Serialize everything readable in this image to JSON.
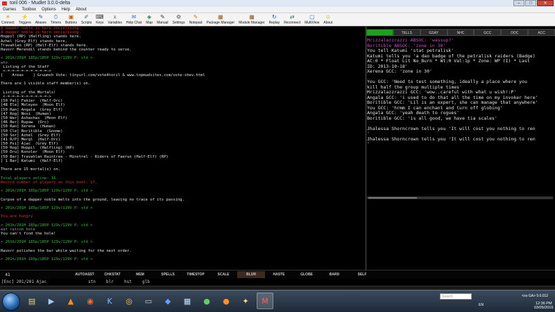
{
  "window": {
    "title": "toril 006 - Mudlet 3.0.0-delta"
  },
  "menubar": [
    "Games",
    "Toolbox",
    "Options",
    "Help",
    "About"
  ],
  "toolbar": [
    {
      "label": "Connect",
      "icon": "connect-icon",
      "glyph": "☀"
    },
    {
      "label": "Triggers",
      "icon": "triggers-icon",
      "glyph": "⚡"
    },
    {
      "label": "Aliases",
      "icon": "aliases-icon",
      "glyph": "✎"
    },
    {
      "label": "Timers",
      "icon": "timers-icon",
      "glyph": "⏱"
    },
    {
      "label": "Buttons",
      "icon": "buttons-icon",
      "glyph": "▣"
    },
    {
      "label": "Scripts",
      "icon": "scripts-icon",
      "glyph": "✐"
    },
    {
      "label": "Keys",
      "icon": "keys-icon",
      "glyph": "⌨"
    },
    {
      "label": "Variables",
      "icon": "variables-icon",
      "glyph": "x"
    },
    {
      "label": "Help Chat",
      "icon": "help-chat-icon",
      "glyph": "✉"
    },
    {
      "label": "Map",
      "icon": "map-icon",
      "glyph": "◈"
    },
    {
      "label": "Manual",
      "icon": "manual-icon",
      "glyph": "✎"
    },
    {
      "label": "Settings",
      "icon": "settings-icon",
      "glyph": "⚙"
    },
    {
      "label": "Notepad",
      "icon": "notepad-icon",
      "glyph": "✎"
    },
    {
      "label": "Package Manager",
      "icon": "package-manager-icon",
      "glyph": "▦"
    },
    {
      "label": "Module Manager",
      "icon": "module-manager-icon",
      "glyph": "▦"
    },
    {
      "label": "Replay",
      "icon": "replay-icon",
      "glyph": "↻"
    },
    {
      "label": "Reconnect",
      "icon": "reconnect-icon",
      "glyph": "⇄"
    },
    {
      "label": "MultiView",
      "icon": "multiview-icon",
      "glyph": "▢"
    },
    {
      "label": "About",
      "icon": "about-icon",
      "glyph": "☺"
    }
  ],
  "main_lines": [
    {
      "t": "A dapper noble is here socializing.",
      "c": "red"
    },
    {
      "t": "A dapper noble is here socializing.",
      "c": "red"
    },
    {
      "t": "Hoppil (RP) (Halfling) stands here.",
      "c": "white"
    },
    {
      "t": "Azhel (Grey Elf) stands here.",
      "c": "white"
    },
    {
      "t": "Travahlan (RP) (Half-Elf) stands here.",
      "c": "white"
    },
    {
      "t": "Havorr Merendil stands behind the counter ready to serve.",
      "c": "white"
    },
    {
      "t": "",
      "c": "white"
    },
    {
      "t": "< 201h/201H 185p/185P 129v/129V P: std >",
      "c": "green"
    },
    {
      "t": "who",
      "c": "gray"
    },
    {
      "t": " Listing of the Staff",
      "c": "white"
    },
    {
      "t": " <-=-=-=-=-=-=-=-=-=->",
      "c": "white"
    },
    {
      "t": "[    Areas    ] Gruumsh Vote: tinyurl.com/vote4toril & www.topmudsites.com/vote-shev.html",
      "c": "white"
    },
    {
      "t": "",
      "c": "white"
    },
    {
      "t": "There are 1 visible staff member(s) on.",
      "c": "white"
    },
    {
      "t": "",
      "c": "white"
    },
    {
      "t": " Listing of the Mortals!",
      "c": "white"
    },
    {
      "t": " <-=-=-=-=-=-=-=-=-=->",
      "c": "white"
    },
    {
      "t": "[50 Pal] Fakier  (Half-Orc)",
      "c": "white"
    },
    {
      "t": "[48 Ele] Moleyen  (Moon Elf)",
      "c": "white"
    },
    {
      "t": "[50 Ran] Angala  (Grey Elf)",
      "c": "white"
    },
    {
      "t": "[47 Rog] Noxi  (Human)",
      "c": "white"
    },
    {
      "t": "[50 War] Ashashas  (Moon Elf)",
      "c": "white"
    },
    {
      "t": "[46 Ber] Rupaw  (Orc)",
      "c": "white"
    },
    {
      "t": "[50 Ran] Xerena  (Human)",
      "c": "white"
    },
    {
      "t": "[50 Cle] Boritible  (Gnome)",
      "c": "white"
    },
    {
      "t": "[50 Sor] Azhel  (Grey Elf)",
      "c": "white"
    },
    {
      "t": "[41 R/P] Mergl  (Half-Orc)",
      "c": "white"
    },
    {
      "t": "[50 Psi] Ajac  (Grey Elf)",
      "c": "white"
    },
    {
      "t": "[50 Rog] Hoppil  (Halfling) (RP)",
      "c": "white"
    },
    {
      "t": "[50 Dru] Konoler  (Moon Elf)",
      "c": "white"
    },
    {
      "t": "[50 Bar] Travahlan Raintree - Minstrel - Riders of Faerun (Half-Elf) (RP)",
      "c": "white"
    },
    {
      "t": "[ 1 Bar] Katumi  (Half-Elf)",
      "c": "white"
    },
    {
      "t": "",
      "c": "white"
    },
    {
      "t": "There are 15 mortal(s) on.",
      "c": "white"
    },
    {
      "t": "",
      "c": "white"
    },
    {
      "t": "Total players online: 16.",
      "c": "green"
    },
    {
      "t": "Record number of players on this boot: 17.",
      "c": "red"
    },
    {
      "t": "",
      "c": "white"
    },
    {
      "t": "< 201h/201H 185p/185P 129v/129V P: std >",
      "c": "green"
    },
    {
      "t": "",
      "c": "white"
    },
    {
      "t": "Corpse of a dapper noble melts into the ground, leaving no trace of its passing.",
      "c": "white"
    },
    {
      "t": "",
      "c": "white"
    },
    {
      "t": "< 201h/201H 185p/185P 129v/129V P: std >",
      "c": "green"
    },
    {
      "t": "",
      "c": "white"
    },
    {
      "t": "You are hungry.",
      "c": "red"
    },
    {
      "t": "",
      "c": "white"
    },
    {
      "t": "< 201h/201H 185p/185P 129v/129V P: std >",
      "c": "green"
    },
    {
      "t": "eat ration hole",
      "c": "gray"
    },
    {
      "t": "You can't find the hole!",
      "c": "white"
    },
    {
      "t": "",
      "c": "white"
    },
    {
      "t": "< 201h/201H 185p/185P 129v/129V P: std >",
      "c": "green"
    },
    {
      "t": "",
      "c": "white"
    },
    {
      "t": "Havorr polishes the bar while waiting for the next order.",
      "c": "white"
    },
    {
      "t": "",
      "c": "white"
    },
    {
      "t": "< 201h/201H 185p/185P 129v/129V P: std >",
      "c": "green"
    }
  ],
  "chat_tabs": [
    "",
    "TELLS",
    "GSAY",
    "NHC",
    "GCC",
    "OOC",
    "ACC"
  ],
  "chat_lines": [
    {
      "t": "Mrizzalazzrazzi ABSOC: 'wassup?'",
      "c": "magenta"
    },
    {
      "t": "Boritible ABSOC: 'zone in 30'",
      "c": "magenta"
    },
    {
      "t": "You tell Katumi 'stat petralisk'",
      "c": "white"
    },
    {
      "t": "Katumi tells you 'a dao badge of the petralisk raiders (Badge)",
      "c": "white"
    },
    {
      "t": "AC:0 * Float Lit No_Burn * Wt:0 Val:1p * Zone: WP (I) * Last",
      "c": "white"
    },
    {
      "t": "ID: 2013-10-18'",
      "c": "white"
    },
    {
      "t": "Xerena GCC: 'zone in 30'",
      "c": "white"
    },
    {
      "t": "",
      "c": "white"
    },
    {
      "t": "You GCC: 'Need to test something, ideally a place where you",
      "c": "white"
    },
    {
      "t": "kill half the group multiple times'",
      "c": "white"
    },
    {
      "t": "Mrizzalazzrazzi GCC: 'wow..careful with what u wish!:P'",
      "c": "white"
    },
    {
      "t": "Angala GCC: 'i used to do that all the time on my invoker here'",
      "c": "white"
    },
    {
      "t": "Boritible GCC: 'Lil is an expert, she can manage that anywhere'",
      "c": "white"
    },
    {
      "t": "You GCC: 'hrmm I can enchant and turn off globing'",
      "c": "white"
    },
    {
      "t": "Angala GCC: 'yeah death to rogues'",
      "c": "white"
    },
    {
      "t": "Boritible GCC: 'is all good, we have tia scales'",
      "c": "white"
    },
    {
      "t": "",
      "c": "white"
    },
    {
      "t": "Jhalessa Shorncrown tells you 'It will cost you nothing to ren",
      "c": "white"
    },
    {
      "t": "'",
      "c": "white"
    },
    {
      "t": "Jhalessa Shorncrown tells you 'It will cost you nothing to ren",
      "c": "white"
    },
    {
      "t": "'",
      "c": "white"
    }
  ],
  "bottom_bar": {
    "number": "41",
    "buttons": [
      "",
      "",
      "AUTOASST",
      "CHKSTAT",
      "MEM",
      "SPELLS",
      "TIMESTOP",
      "SCALE",
      "BLUR",
      "HASTE",
      "GLOBE",
      "BARD",
      "SELF"
    ],
    "active": "BLUR"
  },
  "command_row": {
    "prompt": "[Enc]  201/201  Ajac",
    "cmds": [
      "stn",
      "blr",
      "hst",
      "glb"
    ]
  },
  "taskbar": {
    "search_placeholder": "Search",
    "tray_label": "<no GA> 5:0.012",
    "lang": "EN",
    "time": "12:36 PM",
    "date": "03/05/2015",
    "apps": [
      {
        "icon": "file-explorer-icon",
        "glyph": "▤"
      },
      {
        "icon": "media-player-icon",
        "glyph": "▶"
      },
      {
        "icon": "vlc-icon",
        "glyph": "▲"
      },
      {
        "icon": "firefox-icon",
        "glyph": "◉"
      },
      {
        "icon": "app-k-icon",
        "glyph": "K"
      },
      {
        "icon": "chrome-icon",
        "glyph": "◎"
      },
      {
        "icon": "app-monitor-icon",
        "glyph": "▭"
      },
      {
        "icon": "app-blue-icon",
        "glyph": "◆"
      },
      {
        "icon": "app-grid-icon",
        "glyph": "▦"
      },
      {
        "icon": "app-green-icon",
        "glyph": "●"
      },
      {
        "icon": "app-orange-icon",
        "glyph": "●"
      },
      {
        "icon": "app-star-icon",
        "glyph": "✦"
      },
      {
        "icon": "mudlet-icon",
        "glyph": "M"
      }
    ]
  },
  "colors": {
    "red": "#e03030",
    "green": "#3bbf3b",
    "magenta": "#c64fc6",
    "white": "#e6e6e6",
    "gray": "#9a9a9a",
    "tab_active": "#1ea01e"
  }
}
